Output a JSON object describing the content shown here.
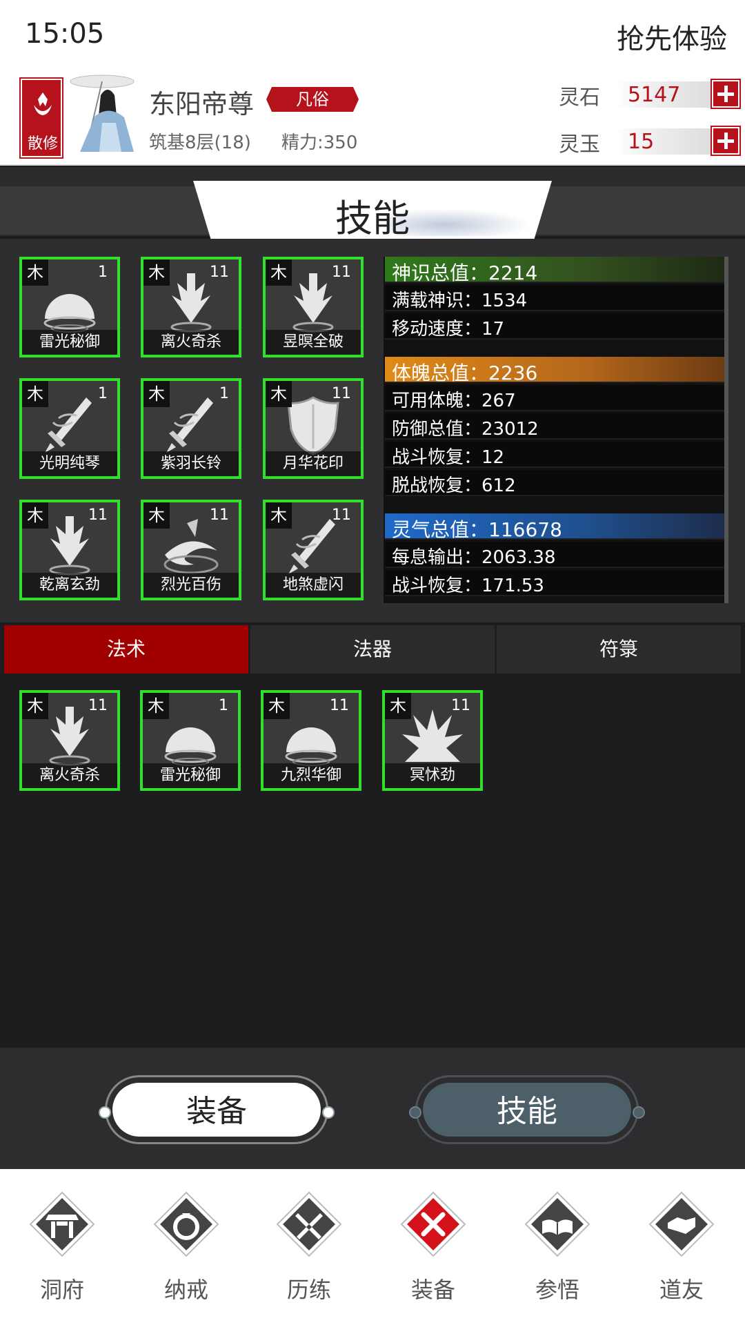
{
  "status": {
    "time": "15:05",
    "action": "抢先体验"
  },
  "player": {
    "sect_label": "散修",
    "name": "东阳帝尊",
    "rank": "凡俗",
    "level": "筑基8层(18)",
    "energy": "精力:350"
  },
  "currency": [
    {
      "label": "灵石",
      "value": "5147"
    },
    {
      "label": "灵玉",
      "value": "15"
    }
  ],
  "section_title": "技能",
  "skills_top": [
    {
      "element": "木",
      "level": "1",
      "name": "雷光秘御",
      "icon": "dome-shield-icon"
    },
    {
      "element": "木",
      "level": "11",
      "name": "离火奇杀",
      "icon": "downward-strike-icon"
    },
    {
      "element": "木",
      "level": "11",
      "name": "昱暝全破",
      "icon": "downward-strike-icon"
    },
    {
      "element": "木",
      "level": "1",
      "name": "光明纯琴",
      "icon": "sword-icon"
    },
    {
      "element": "木",
      "level": "1",
      "name": "紫羽长铃",
      "icon": "sword-icon"
    },
    {
      "element": "木",
      "level": "11",
      "name": "月华花印",
      "icon": "shield-icon"
    },
    {
      "element": "木",
      "level": "11",
      "name": "乾离玄劲",
      "icon": "downward-strike-icon"
    },
    {
      "element": "木",
      "level": "11",
      "name": "烈光百伤",
      "icon": "swirl-icon"
    },
    {
      "element": "木",
      "level": "11",
      "name": "地煞虚闪",
      "icon": "sword-icon"
    }
  ],
  "stats": [
    {
      "text": "神识总值：2214",
      "style": "green"
    },
    {
      "text": "满载神识：1534",
      "style": "plain"
    },
    {
      "text": "移动速度：17",
      "style": "plain"
    },
    {
      "text": "体魄总值：2236",
      "style": "orange"
    },
    {
      "text": "可用体魄：267",
      "style": "plain"
    },
    {
      "text": "防御总值：23012",
      "style": "plain"
    },
    {
      "text": "战斗恢复：12",
      "style": "plain"
    },
    {
      "text": "脱战恢复：612",
      "style": "plain"
    },
    {
      "text": "灵气总值：116678",
      "style": "blue"
    },
    {
      "text": "每息输出：2063.38",
      "style": "plain"
    },
    {
      "text": "战斗恢复：171.53",
      "style": "plain"
    }
  ],
  "tabs": [
    {
      "label": "法术",
      "active": true
    },
    {
      "label": "法器",
      "active": false
    },
    {
      "label": "符箓",
      "active": false
    }
  ],
  "skills_equipped": [
    {
      "element": "木",
      "level": "11",
      "name": "离火奇杀",
      "icon": "downward-strike-icon"
    },
    {
      "element": "木",
      "level": "1",
      "name": "雷光秘御",
      "icon": "dome-shield-icon"
    },
    {
      "element": "木",
      "level": "11",
      "name": "九烈华御",
      "icon": "dome-shield-icon"
    },
    {
      "element": "木",
      "level": "11",
      "name": "冥怵劲",
      "icon": "burst-icon"
    }
  ],
  "switch": {
    "left": "装备",
    "right": "技能"
  },
  "nav": [
    {
      "label": "洞府",
      "icon": "gate-icon",
      "active": false
    },
    {
      "label": "纳戒",
      "icon": "ring-icon",
      "active": false
    },
    {
      "label": "历练",
      "icon": "crossed-swords-icon",
      "active": false
    },
    {
      "label": "装备",
      "icon": "close-icon",
      "active": true
    },
    {
      "label": "参悟",
      "icon": "book-icon",
      "active": false
    },
    {
      "label": "道友",
      "icon": "handshake-icon",
      "active": false
    }
  ],
  "colors": {
    "accent_red": "#b5121b",
    "tab_active": "#a00000",
    "skill_border": "#30e02a"
  }
}
